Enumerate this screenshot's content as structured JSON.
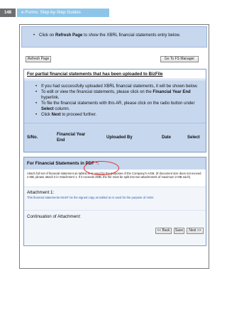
{
  "header": {
    "page_number": "148",
    "section": "e-Forms: Step-by-Step Guides"
  },
  "top_instruction": {
    "prefix": "Click on ",
    "bold": "Refresh Page",
    "suffix": " to show the XBRL financial statements entry below."
  },
  "buttons": {
    "refresh": "Refresh Page",
    "goto": "Go To FS Manager",
    "back": "<< Back",
    "save": "Save",
    "next": "Next >>"
  },
  "partial": {
    "title": "For partial financial statements that has been uploaded to BizFile",
    "items": [
      {
        "text": "If you had successfully uploaded XBRL financial statements, it will be shown below."
      },
      {
        "pre": "To edit or view the financial statements, please click on the ",
        "bold": "Financial Year End",
        "post": " hyperlink."
      },
      {
        "pre": "To file the financial statements with this AR, please click on the radio button under ",
        "bold": "Select",
        "post": " column."
      },
      {
        "pre": "Click ",
        "bold": "Next",
        "post": " to proceed further."
      }
    ],
    "columns": [
      "S/No.",
      "Financial Year End",
      "Uploaded By",
      "Date",
      "Select"
    ]
  },
  "pdf": {
    "title": "For Financial Statements in PDF",
    "star": "*",
    "colon": ":",
    "desc": "Attach full set of financial statement as tabled at or used for the purposes of the Company's AGM. (If document size does not exceed 2 MB, please attach it in Attachment 1. If it exceeds 2MB, the file must be split into two attachments of maximum 2 MB each)",
    "attachment_label": "Attachment 1:",
    "attachment_note": "This financial statements MUST be the signed copy as tabled at or used for the purpose of AGM.",
    "continuation": "Continuation of Attachment:"
  },
  "colors": {
    "panel": "#c7d7ee",
    "badge": "#8dc5e8",
    "highlight": "#e23030"
  }
}
